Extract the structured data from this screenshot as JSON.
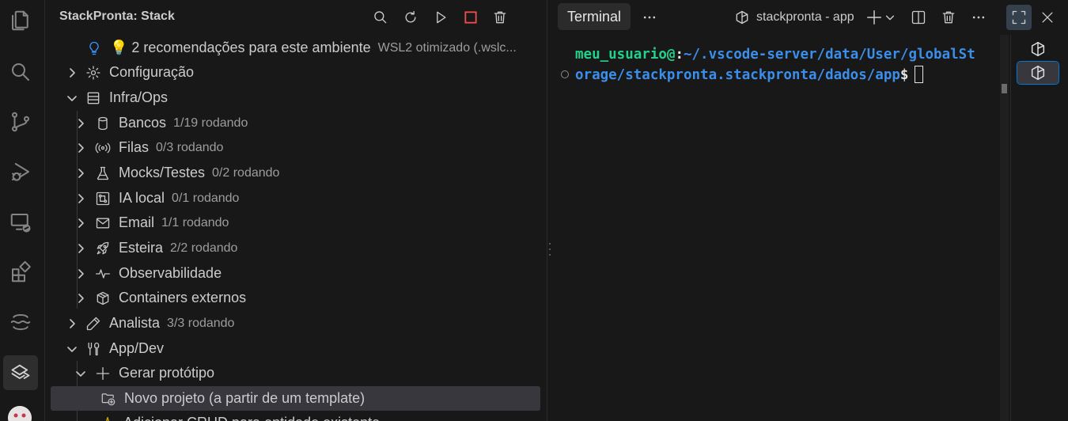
{
  "sidebar": {
    "title": "StackPronta: Stack",
    "rows": [
      {
        "label": "💡 2 recomendações para este ambiente",
        "desc": "WSL2 otimizado (.wslc..."
      },
      {
        "label": "Configuração",
        "desc": ""
      },
      {
        "label": "Infra/Ops",
        "desc": ""
      },
      {
        "label": "Bancos",
        "desc": "1/19 rodando"
      },
      {
        "label": "Filas",
        "desc": "0/3 rodando"
      },
      {
        "label": "Mocks/Testes",
        "desc": "0/2 rodando"
      },
      {
        "label": "IA local",
        "desc": "0/1 rodando"
      },
      {
        "label": "Email",
        "desc": "1/1 rodando"
      },
      {
        "label": "Esteira",
        "desc": "2/2 rodando"
      },
      {
        "label": "Observabilidade",
        "desc": ""
      },
      {
        "label": "Containers externos",
        "desc": ""
      },
      {
        "label": "Analista",
        "desc": "3/3 rodando"
      },
      {
        "label": "App/Dev",
        "desc": ""
      },
      {
        "label": "Gerar protótipo",
        "desc": ""
      },
      {
        "label": "Novo projeto (a partir de um template)",
        "desc": ""
      },
      {
        "label": "Adicionar CRUD para entidade existente",
        "desc": ""
      }
    ]
  },
  "panel": {
    "tab_label": "Terminal",
    "terminal_name": "stackpronta - app",
    "prompt": {
      "user": "meu_usuario@",
      "sep": ":",
      "path_line1": "~/.vscode-server/data/User/globalSt",
      "path_line2": "orage/stackpronta.stackpronta/dados/app",
      "symbol": "$"
    }
  },
  "colors": {
    "background": "#181818",
    "user": "#23d18b",
    "path": "#3b8eea",
    "stop": "#f14c4c",
    "selection": "#37373d",
    "focus": "#0078d4"
  },
  "icons": {
    "activity": [
      "explorer-icon",
      "search-icon",
      "source-control-icon",
      "run-debug-icon",
      "remote-explorer-icon",
      "extensions-icon",
      "wave-icon",
      "stackpronta-icon",
      "account-avatar"
    ],
    "header": [
      "search-icon",
      "refresh-icon",
      "play-icon",
      "stop-icon",
      "trash-icon"
    ],
    "panel": [
      "more-icon",
      "terminal-shell-icon",
      "plus-icon",
      "chevron-down-icon",
      "split-icon",
      "trash-icon",
      "more-icon",
      "maximize-icon",
      "close-icon"
    ]
  }
}
